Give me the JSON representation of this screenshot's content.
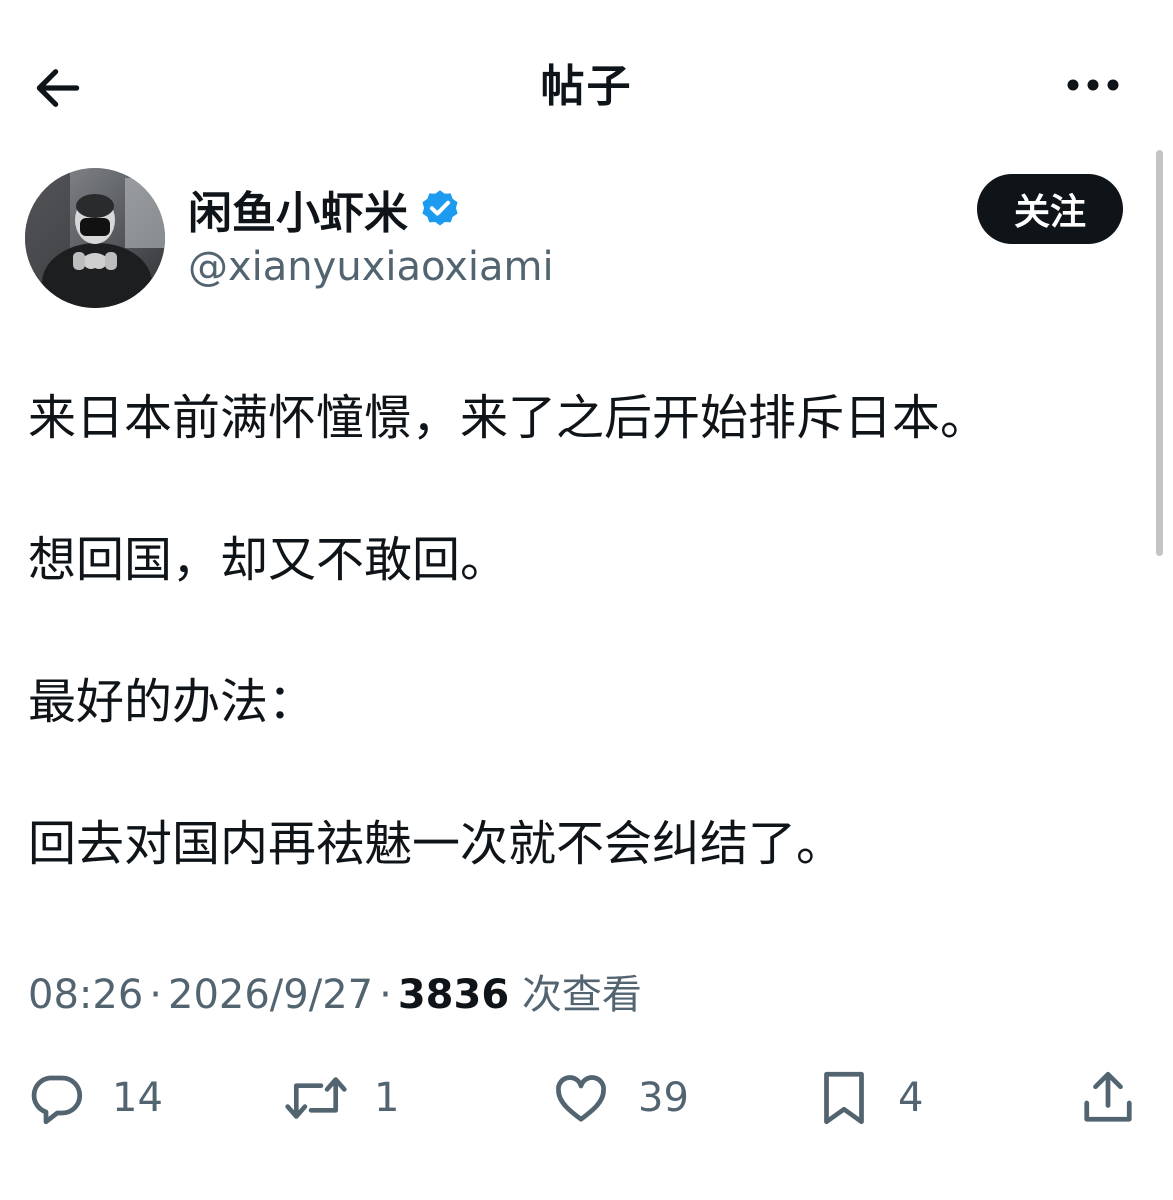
{
  "header": {
    "title": "帖子",
    "back_icon": "arrow-left-icon",
    "more_icon": "more-horizontal-icon"
  },
  "author": {
    "display_name": "闲鱼小虾米",
    "handle": "@xianyuxiaoxiami",
    "verified": true,
    "verified_color": "#1d9bf0",
    "follow_label": "关注"
  },
  "post": {
    "lines": [
      "来日本前满怀憧憬，来了之后开始排斥日本。",
      "想回国，却又不敢回。",
      "最好的办法：",
      "回去对国内再祛魅一次就不会纠结了。"
    ]
  },
  "meta": {
    "time": "08:26",
    "date": "2026/9/27",
    "views": "3836",
    "views_label": "次查看",
    "separator": "·"
  },
  "actions": {
    "reply_count": "14",
    "retweet_count": "1",
    "like_count": "39",
    "bookmark_count": "4"
  },
  "colors": {
    "text_primary": "#0f1419",
    "text_secondary": "#536471",
    "follow_bg": "#0f1419",
    "accent_blue": "#1d9bf0"
  }
}
